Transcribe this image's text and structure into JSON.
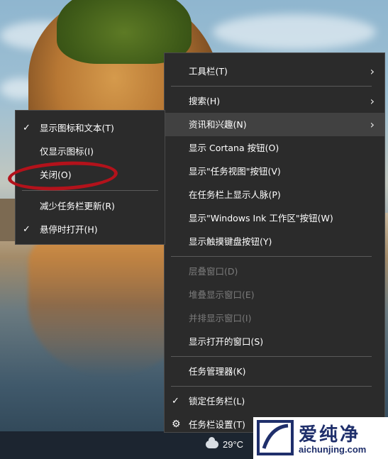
{
  "taskbar": {
    "weather_temp": "29°C"
  },
  "main_menu": {
    "groups": [
      [
        {
          "label": "工具栏(T)",
          "submenu": true
        }
      ],
      [
        {
          "label": "搜索(H)",
          "submenu": true
        },
        {
          "label": "资讯和兴趣(N)",
          "submenu": true,
          "highlighted": true
        },
        {
          "label": "显示 Cortana 按钮(O)"
        },
        {
          "label": "显示\"任务视图\"按钮(V)"
        },
        {
          "label": "在任务栏上显示人脉(P)"
        },
        {
          "label": "显示\"Windows Ink 工作区\"按钮(W)"
        },
        {
          "label": "显示触摸键盘按钮(Y)"
        }
      ],
      [
        {
          "label": "层叠窗口(D)",
          "disabled": true
        },
        {
          "label": "堆叠显示窗口(E)",
          "disabled": true
        },
        {
          "label": "并排显示窗口(I)",
          "disabled": true
        },
        {
          "label": "显示打开的窗口(S)"
        }
      ],
      [
        {
          "label": "任务管理器(K)"
        }
      ],
      [
        {
          "label": "锁定任务栏(L)",
          "checked": true
        },
        {
          "label": "任务栏设置(T)",
          "icon": "gear-icon"
        }
      ]
    ]
  },
  "sub_menu": {
    "groups": [
      [
        {
          "label": "显示图标和文本(T)",
          "checked": true
        },
        {
          "label": "仅显示图标(I)"
        },
        {
          "label": "关闭(O)",
          "annotated": true
        }
      ],
      [
        {
          "label": "减少任务栏更新(R)"
        },
        {
          "label": "悬停时打开(H)",
          "checked": true
        }
      ]
    ]
  },
  "watermark": {
    "title": "爱纯净",
    "url": "aichunjing.com"
  },
  "colors": {
    "menu_bg": "#2b2b2b",
    "highlight": "#414141",
    "annotation": "#b3121b",
    "brand": "#1f2f6b"
  }
}
